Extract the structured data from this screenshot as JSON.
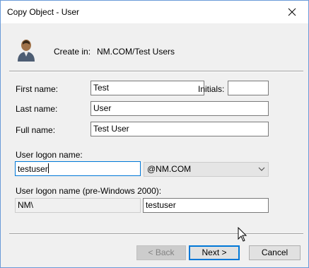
{
  "window": {
    "title": "Copy Object - User"
  },
  "header": {
    "create_in_label": "Create in:",
    "create_in_value": "NM.COM/Test Users"
  },
  "form": {
    "first_name_label": "First name:",
    "first_name_value": "Test",
    "initials_label": "Initials:",
    "initials_value": "",
    "last_name_label": "Last name:",
    "last_name_value": "User",
    "full_name_label": "Full name:",
    "full_name_value": "Test User",
    "logon_name_label": "User logon name:",
    "logon_name_value": "testuser",
    "domain_suffix_value": "@NM.COM",
    "pre2000_label": "User logon name (pre-Windows 2000):",
    "pre2000_domain_value": "NM\\",
    "pre2000_name_value": "testuser"
  },
  "buttons": {
    "back_label": "< Back",
    "next_label": "Next >",
    "cancel_label": "Cancel"
  },
  "icons": {
    "close": "close-icon",
    "user": "user-icon",
    "chevron": "chevron-down-icon",
    "cursor": "mouse-pointer-icon"
  },
  "colors": {
    "focus_border": "#0078d7",
    "window_bg": "#f0f0f0"
  }
}
